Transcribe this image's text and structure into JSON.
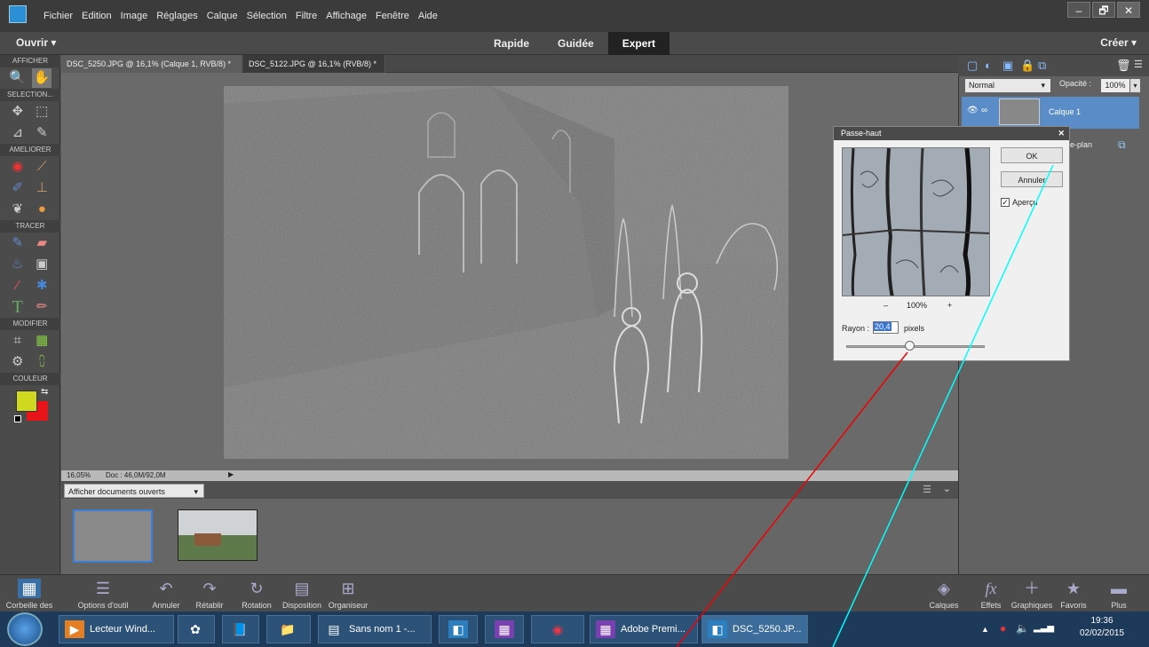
{
  "menubar": {
    "items": [
      "Fichier",
      "Edition",
      "Image",
      "Réglages",
      "Calque",
      "Sélection",
      "Filtre",
      "Affichage",
      "Fenêtre",
      "Aide"
    ],
    "win_min": "–",
    "win_max": "🗗",
    "win_close": "✕"
  },
  "modebar": {
    "open_label": "Ouvrir",
    "modes": [
      "Rapide",
      "Guidée",
      "Expert"
    ],
    "active_mode": "Expert",
    "create_label": "Créer"
  },
  "toolbox": {
    "sections": [
      "AFFICHER",
      "SELECTION...",
      "AMELIORER",
      "TRACER",
      "MODIFIER",
      "COULEUR"
    ],
    "fg_color": "#cfd91e",
    "bg_color": "#e8141a"
  },
  "tabs": [
    "DSC_5250.JPG @ 16,1% (Calque 1, RVB/8) * ×",
    "DSC_5122.JPG @ 16,1% (RVB/8) * ×"
  ],
  "status": {
    "zoom": "16,05%",
    "doc": "Doc : 46,0M/92,0M"
  },
  "bin": {
    "dropdown": "Afficher documents ouverts"
  },
  "layers": {
    "blend_mode": "Normal",
    "opacity_label": "Opacité :",
    "opacity_value": "100%",
    "layer1_name": "Calque 1",
    "background_partial": "e-plan"
  },
  "dialog": {
    "title": "Passe-haut",
    "ok": "OK",
    "cancel": "Annuler",
    "preview_label": "Aperçu",
    "preview_checked": true,
    "zoom_minus": "–",
    "zoom": "100%",
    "zoom_plus": "+",
    "radius_label": "Rayon :",
    "radius_value": "20,4",
    "radius_unit": "pixels"
  },
  "bottombar": {
    "left": [
      "Corbeille des photos",
      "Options d'outil",
      "Annuler",
      "Rétablir",
      "Rotation",
      "Disposition",
      "Organiseur"
    ],
    "right": [
      "Calques",
      "Effets",
      "Graphiques",
      "Favoris",
      "Plus"
    ]
  },
  "taskbar": {
    "items": [
      "Lecteur Wind...",
      "Sans nom 1 -...",
      "Adobe Premi...",
      "DSC_5250.JP..."
    ],
    "time": "19:36",
    "date": "02/02/2015"
  }
}
